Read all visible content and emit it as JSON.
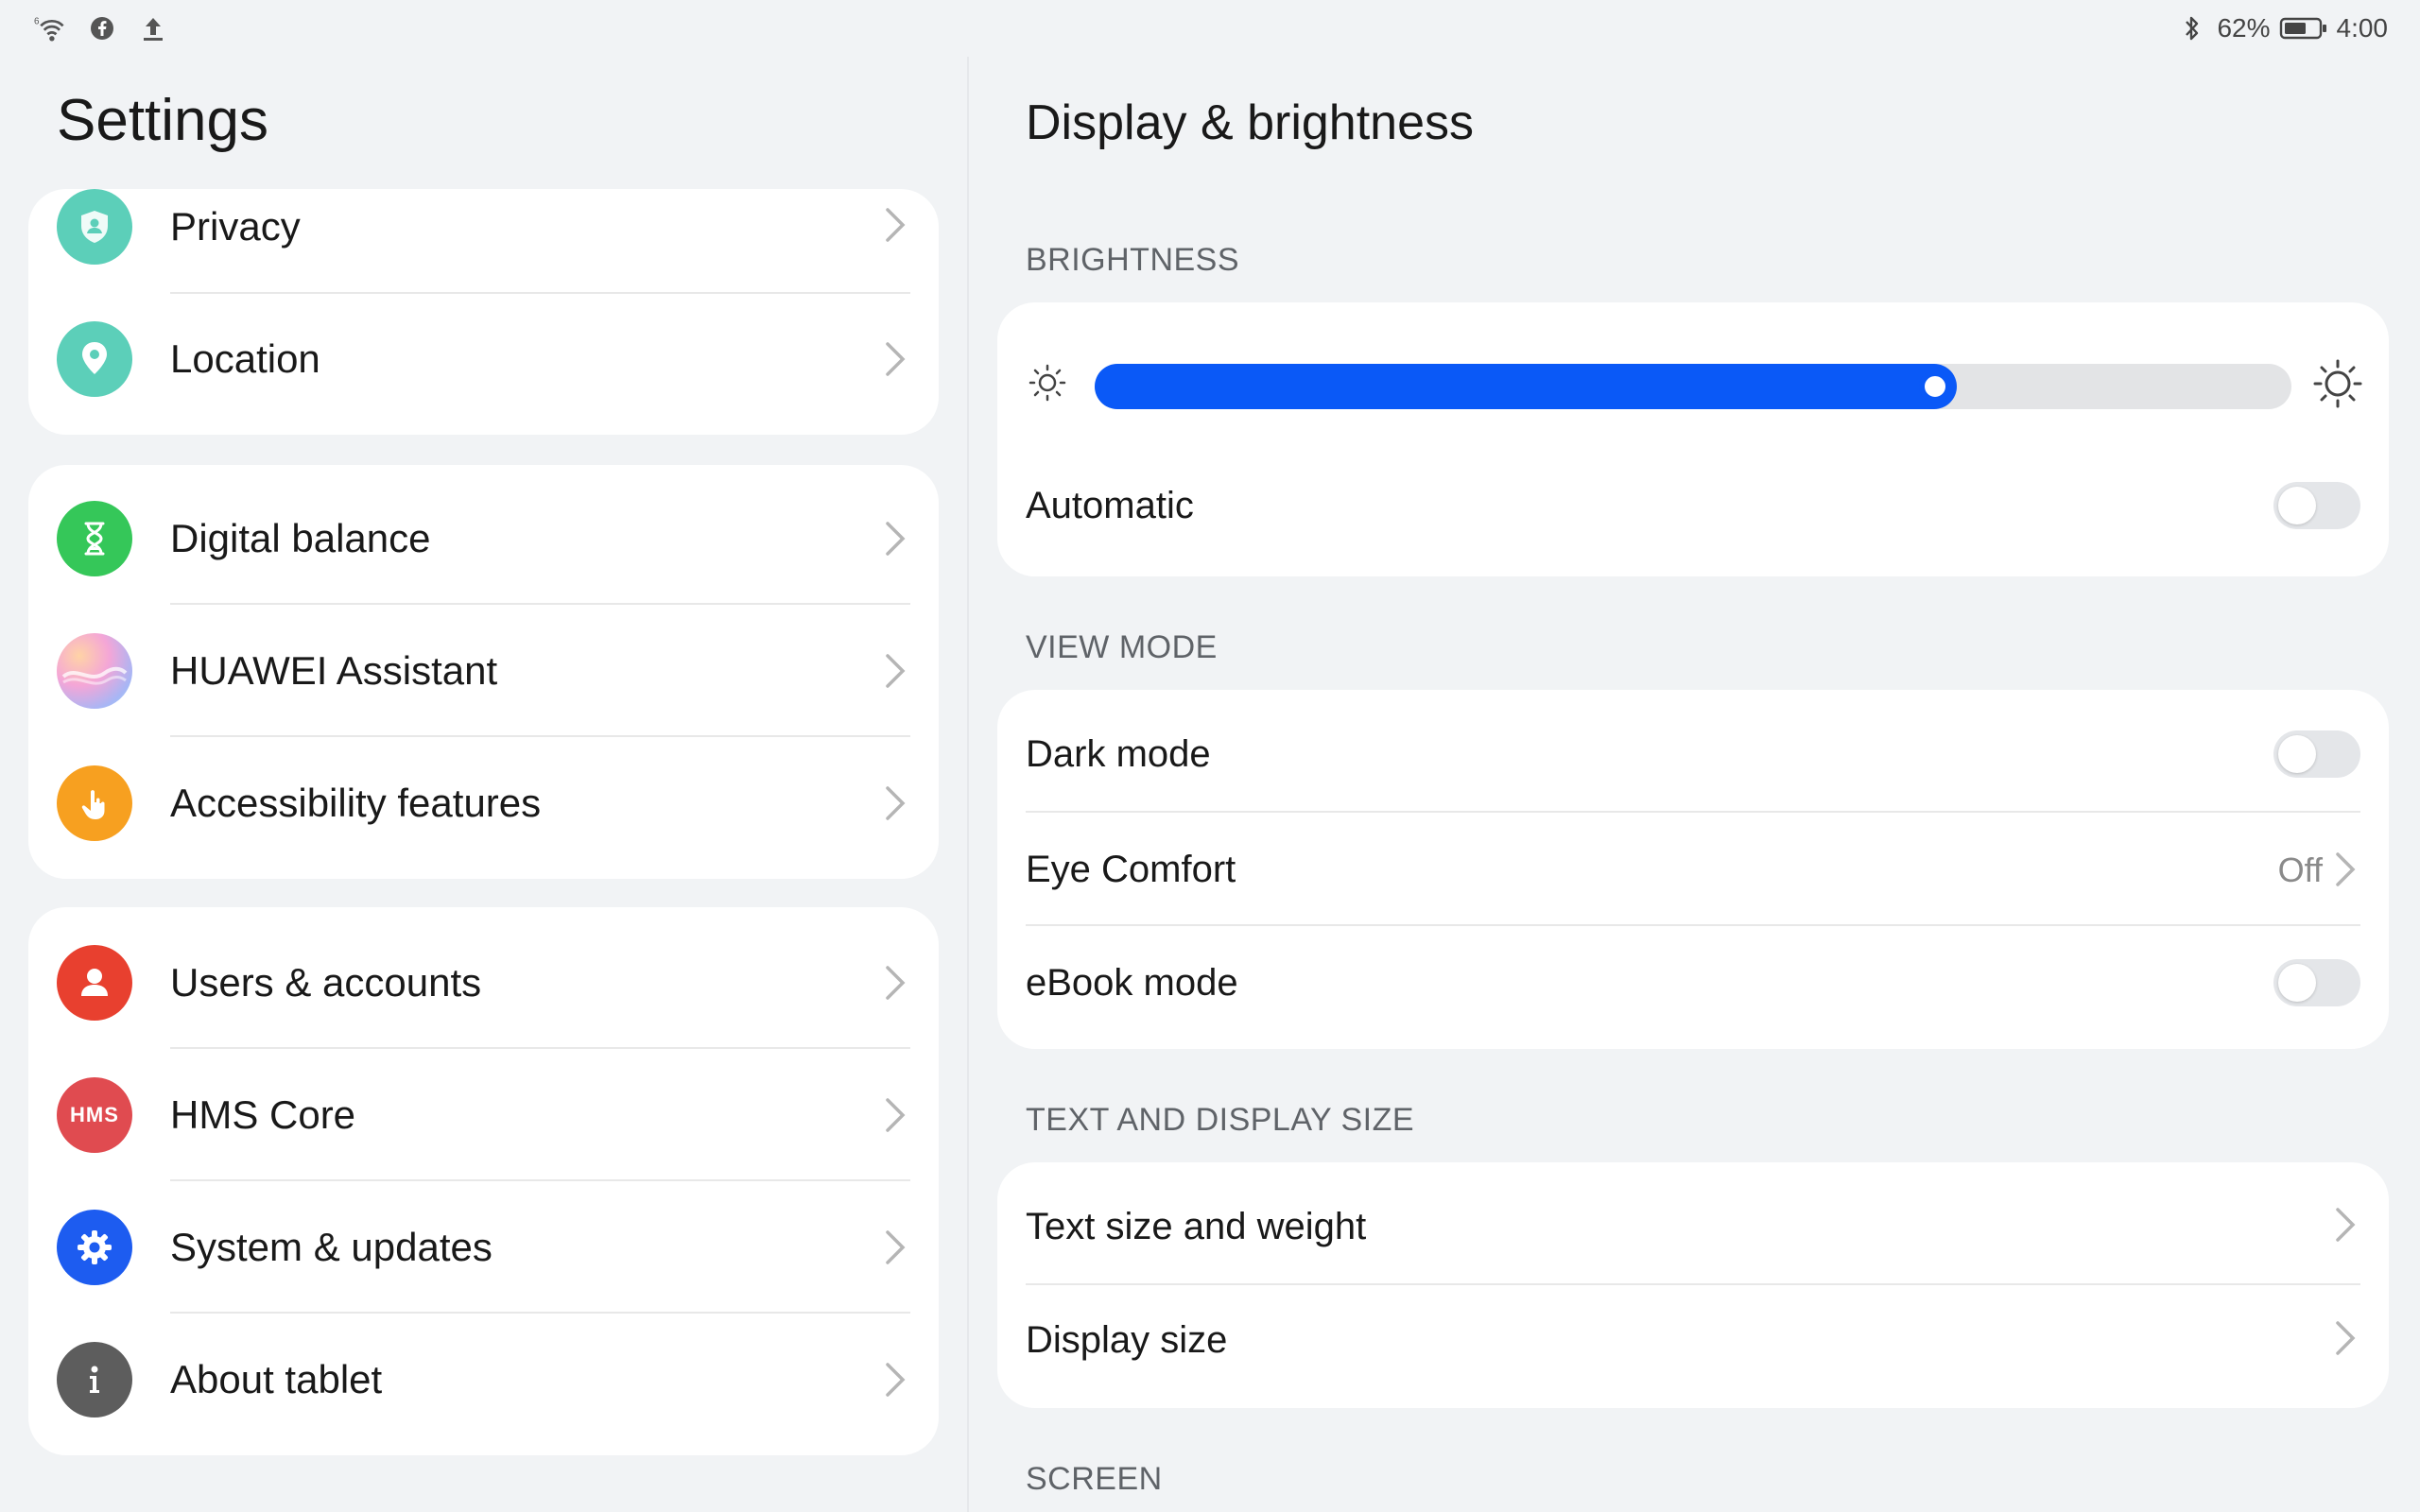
{
  "status_bar": {
    "left_icons": [
      "wifi-6-icon",
      "facebook-icon",
      "upload-icon"
    ],
    "battery_percent": "62%",
    "time": "4:00",
    "wifi_badge": "6"
  },
  "left_pane": {
    "title": "Settings",
    "groups": [
      [
        {
          "label": "Privacy",
          "icon": "privacy-shield-icon",
          "color": "#5ccfb9"
        },
        {
          "label": "Location",
          "icon": "location-pin-icon",
          "color": "#5ccfb9"
        }
      ],
      [
        {
          "label": "Digital balance",
          "icon": "hourglass-icon",
          "color": "#35c759"
        },
        {
          "label": "HUAWEI Assistant",
          "icon": "huawei-assistant-icon",
          "color": "#e9a3d8"
        },
        {
          "label": "Accessibility features",
          "icon": "hand-tap-icon",
          "color": "#f7a020"
        }
      ],
      [
        {
          "label": "Users & accounts",
          "icon": "user-icon",
          "color": "#e8402f"
        },
        {
          "label": "HMS Core",
          "icon": "hms-core-icon",
          "icon_text": "HMS",
          "color": "#e04b50"
        },
        {
          "label": "System & updates",
          "icon": "gear-icon",
          "color": "#1d5cf0"
        },
        {
          "label": "About tablet",
          "icon": "info-icon",
          "color": "#5d5d5d"
        }
      ]
    ]
  },
  "right_pane": {
    "title": "Display & brightness",
    "brightness": {
      "header": "BRIGHTNESS",
      "level": 0.72,
      "automatic_label": "Automatic",
      "automatic_on": false
    },
    "view_mode": {
      "header": "VIEW MODE",
      "dark_mode_label": "Dark mode",
      "eye_comfort_label": "Eye Comfort",
      "eye_comfort_value": "Off",
      "ebook_label": "eBook mode"
    },
    "text_display": {
      "header": "TEXT AND DISPLAY SIZE",
      "text_size_label": "Text size and weight",
      "display_size_label": "Display size"
    },
    "screen": {
      "header": "SCREEN"
    }
  },
  "colors": {
    "accent": "#0a59f7",
    "background": "#f1f3f5",
    "card": "#ffffff"
  }
}
